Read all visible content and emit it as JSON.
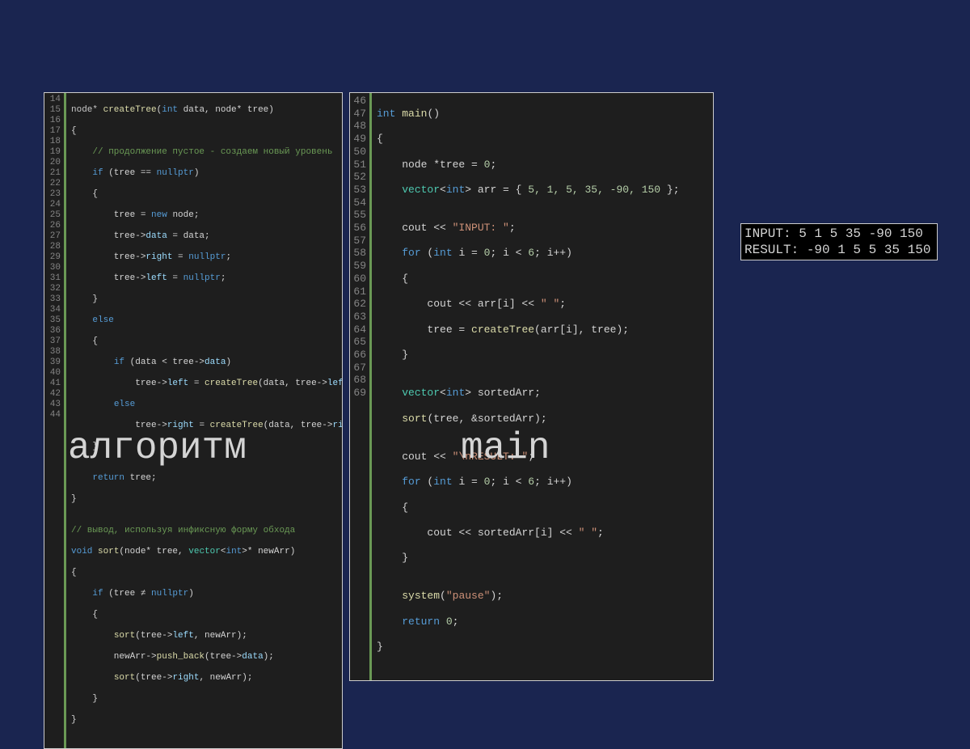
{
  "captions": {
    "left": "алгоритм",
    "right": "main"
  },
  "output": {
    "line1": "INPUT: 5 1 5 35 -90 150",
    "line2": "RESULT:  -90 1 5 5 35 150"
  },
  "gutter": {
    "left": [
      "14",
      "15",
      "16",
      "17",
      "18",
      "19",
      "20",
      "21",
      "22",
      "23",
      "24",
      "25",
      "26",
      "27",
      "28",
      "29",
      "30",
      "31",
      "32",
      "33",
      "34",
      "35",
      "36",
      "37",
      "38",
      "39",
      "40",
      "41",
      "42",
      "43",
      "44"
    ],
    "right": [
      "46",
      "47",
      "48",
      "49",
      "50",
      "51",
      "52",
      "53",
      "54",
      "55",
      "56",
      "57",
      "58",
      "59",
      "60",
      "61",
      "62",
      "63",
      "64",
      "65",
      "66",
      "67",
      "68",
      "69"
    ]
  },
  "code_left": {
    "l14_a": "node* ",
    "l14_fn": "createTree",
    "l14_b": "(",
    "l14_kw1": "int",
    "l14_c": " data, node* tree)",
    "l15": "{",
    "l16_cm": "    // продолжение пустое - создаем новый уровень",
    "l17_a": "    ",
    "l17_kw": "if",
    "l17_b": " (tree == ",
    "l17_kw2": "nullptr",
    "l17_c": ")",
    "l18": "    {",
    "l19_a": "        tree = ",
    "l19_kw": "new",
    "l19_b": " node;",
    "l20_a": "        tree->",
    "l20_var": "data",
    "l20_b": " = data;",
    "l21_a": "        tree->",
    "l21_var": "right",
    "l21_b": " = ",
    "l21_kw": "nullptr",
    "l21_c": ";",
    "l22_a": "        tree->",
    "l22_var": "left",
    "l22_b": " = ",
    "l22_kw": "nullptr",
    "l22_c": ";",
    "l23": "    }",
    "l24_a": "    ",
    "l24_kw": "else",
    "l25": "    {",
    "l26_a": "        ",
    "l26_kw": "if",
    "l26_b": " (data < tree->",
    "l26_var": "data",
    "l26_c": ")",
    "l27_a": "            tree->",
    "l27_var": "left",
    "l27_b": " = ",
    "l27_fn": "createTree",
    "l27_c": "(data, tree->",
    "l27_var2": "left",
    "l27_d": ");",
    "l28_a": "        ",
    "l28_kw": "else",
    "l29_a": "            tree->",
    "l29_var": "right",
    "l29_b": " = ",
    "l29_fn": "createTree",
    "l29_c": "(data, tree->",
    "l29_var2": "right",
    "l29_d": ");",
    "l30": "    }",
    "l31": "",
    "l32_a": "    ",
    "l32_kw": "return",
    "l32_b": " tree;",
    "l33": "}",
    "l34": "",
    "l35_cm": "// вывод, используя инфиксную форму обхода",
    "l36_kw": "void",
    "l36_a": " ",
    "l36_fn": "sort",
    "l36_b": "(node* tree, ",
    "l36_tpl": "vector",
    "l36_c": "<",
    "l36_kw2": "int",
    "l36_d": ">* newArr)",
    "l37": "{",
    "l38_a": "    ",
    "l38_kw": "if",
    "l38_b": " (tree ≠ ",
    "l38_kw2": "nullptr",
    "l38_c": ")",
    "l39": "    {",
    "l40_a": "        ",
    "l40_fn": "sort",
    "l40_b": "(tree->",
    "l40_var": "left",
    "l40_c": ", newArr);",
    "l41_a": "        newArr->",
    "l41_fn": "push_back",
    "l41_b": "(tree->",
    "l41_var": "data",
    "l41_c": ");",
    "l42_a": "        ",
    "l42_fn": "sort",
    "l42_b": "(tree->",
    "l42_var": "right",
    "l42_c": ", newArr);",
    "l43": "    }",
    "l44": "}"
  },
  "code_right": {
    "l46_kw": "int",
    "l46_a": " ",
    "l46_fn": "main",
    "l46_b": "()",
    "l47": "{",
    "l48_a": "    node *tree = ",
    "l48_num": "0",
    "l48_b": ";",
    "l49_a": "    ",
    "l49_tpl": "vector",
    "l49_b": "<",
    "l49_kw": "int",
    "l49_c": "> arr = { ",
    "l49_num": "5, 1, 5, 35, -90, 150",
    "l49_d": " };",
    "l50": "",
    "l51_a": "    cout << ",
    "l51_str": "\"INPUT: \"",
    "l51_b": ";",
    "l52_a": "    ",
    "l52_kw": "for",
    "l52_b": " (",
    "l52_kw2": "int",
    "l52_c": " i = ",
    "l52_num1": "0",
    "l52_d": "; i < ",
    "l52_num2": "6",
    "l52_e": "; i++)",
    "l53": "    {",
    "l54_a": "        cout << arr[i] << ",
    "l54_str": "\" \"",
    "l54_b": ";",
    "l55_a": "        tree = ",
    "l55_fn": "createTree",
    "l55_b": "(arr[i], tree);",
    "l56": "    }",
    "l57": "",
    "l58_a": "    ",
    "l58_tpl": "vector",
    "l58_b": "<",
    "l58_kw": "int",
    "l58_c": "> sortedArr;",
    "l59_a": "    ",
    "l59_fn": "sort",
    "l59_b": "(tree, &sortedArr);",
    "l60": "",
    "l61_a": "    cout << ",
    "l61_str": "\"\\nRESULT: \"",
    "l61_b": ";",
    "l62_a": "    ",
    "l62_kw": "for",
    "l62_b": " (",
    "l62_kw2": "int",
    "l62_c": " i = ",
    "l62_num1": "0",
    "l62_d": "; i < ",
    "l62_num2": "6",
    "l62_e": "; i++)",
    "l63": "    {",
    "l64_a": "        cout << sortedArr[i] << ",
    "l64_str": "\" \"",
    "l64_b": ";",
    "l65": "    }",
    "l66": "",
    "l67_a": "    ",
    "l67_fn": "system",
    "l67_b": "(",
    "l67_str": "\"pause\"",
    "l67_c": ");",
    "l68_a": "    ",
    "l68_kw": "return",
    "l68_b": " ",
    "l68_num": "0",
    "l68_c": ";",
    "l69": "}"
  }
}
